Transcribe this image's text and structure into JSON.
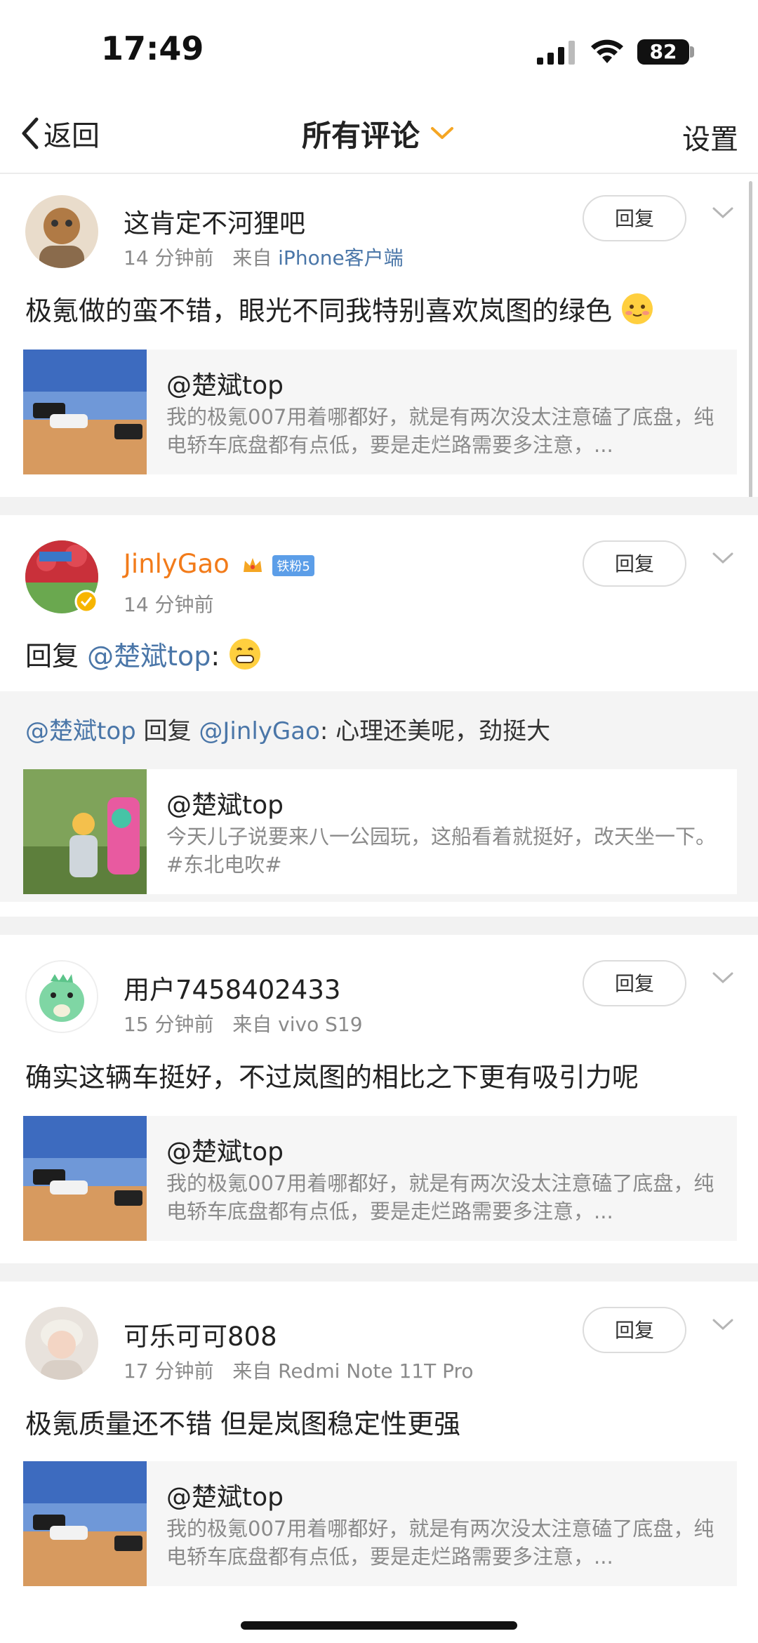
{
  "status_bar": {
    "time": "17:49",
    "battery": "82"
  },
  "nav": {
    "back_label": "返回",
    "title": "所有评论",
    "settings_label": "设置"
  },
  "comments": [
    {
      "username": "这肯定不河狸吧",
      "time": "14 分钟前",
      "from_prefix": "来自",
      "device": "iPhone客户端",
      "reply_label": "回复",
      "text": "极氪做的蛮不错，眼光不同我特别喜欢岚图的绿色",
      "card": {
        "author": "@楚斌top",
        "desc": "我的极氪007用着哪都好，就是有两次没太注意磕了底盘，纯电轿车底盘都有点低，要是走烂路需要多注意，..."
      }
    },
    {
      "username": "JinlyGao",
      "fan_badge": "铁粉5",
      "time": "14 分钟前",
      "reply_label": "回复",
      "text_prefix": "回复",
      "mention": "@楚斌top",
      "text_suffix": ":",
      "quote": {
        "author": "@楚斌top",
        "verb": "回复",
        "target": "@JinlyGao",
        "text": ": 心理还美呢，劲挺大"
      },
      "card": {
        "author": "@楚斌top",
        "desc": "今天儿子说要来八一公园玩，这船看着就挺好，改天坐一下。 #东北电吹#"
      }
    },
    {
      "username": "用户7458402433",
      "time": "15 分钟前",
      "from_prefix": "来自",
      "device": "vivo S19",
      "reply_label": "回复",
      "text": "确实这辆车挺好，不过岚图的相比之下更有吸引力呢",
      "card": {
        "author": "@楚斌top",
        "desc": "我的极氪007用着哪都好，就是有两次没太注意磕了底盘，纯电轿车底盘都有点低，要是走烂路需要多注意，..."
      }
    },
    {
      "username": "可乐可可808",
      "time": "17 分钟前",
      "from_prefix": "来自",
      "device": "Redmi Note 11T Pro",
      "reply_label": "回复",
      "text": "极氪质量还不错 但是岚图稳定性更强",
      "card": {
        "author": "@楚斌top",
        "desc": "我的极氪007用着哪都好，就是有两次没太注意磕了底盘，纯电轿车底盘都有点低，要是走烂路需要多注意，..."
      }
    }
  ],
  "colors": {
    "link": "#4a76a8",
    "vip_name": "#f27b1a",
    "accent_chevron": "#f5a623"
  }
}
